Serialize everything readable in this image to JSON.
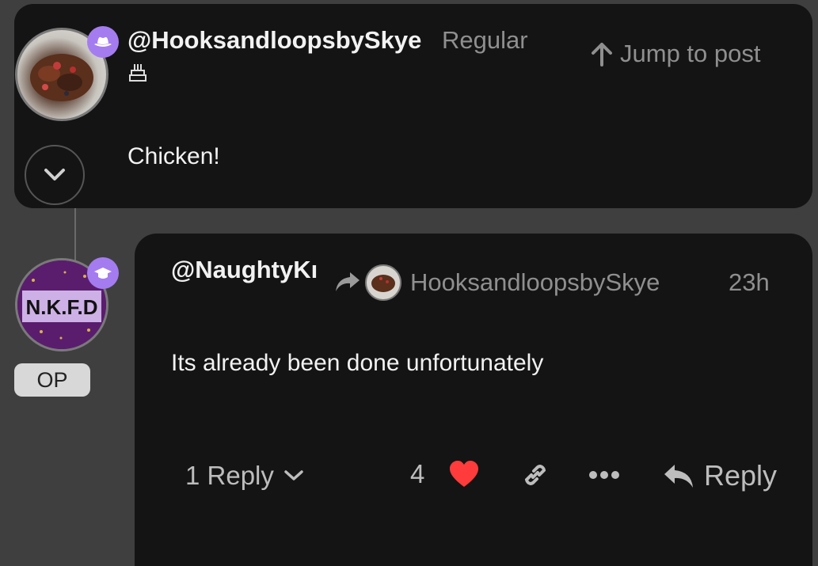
{
  "post1": {
    "username": "@HooksandloopsbySkye",
    "rank": "Regular",
    "jump_label": "Jump to post",
    "body": "Chicken!"
  },
  "post2": {
    "username": "@NaughtyKı",
    "reply_to_name": "HooksandloopsbySkye",
    "time": "23h",
    "body": "Its already been done unfortunately",
    "op_label": "OP",
    "avatar_text": "N.K.F.D",
    "replies_label": "1 Reply",
    "like_count": "4",
    "reply_label": "Reply"
  },
  "colors": {
    "background": "#3f3f3f",
    "card": "#141414",
    "badge_purple": "#a47cf0",
    "heart": "#ff3b3b"
  },
  "icons": [
    "hat-icon",
    "cake-icon",
    "chevron-down-icon",
    "graduation-cap-icon",
    "share-arrow-icon",
    "heart-icon",
    "link-icon",
    "more-icon",
    "reply-arrow-icon",
    "arrow-up-icon"
  ]
}
